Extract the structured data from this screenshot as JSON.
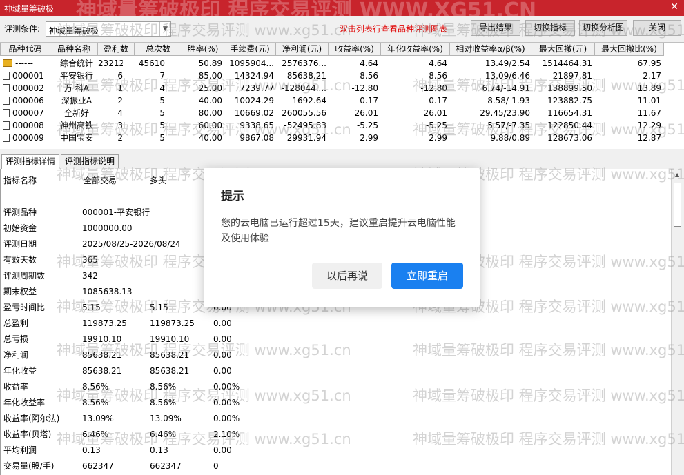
{
  "window": {
    "title": "神域量筹破极",
    "close_glyph": "✕",
    "top_watermark": "神域量筹破极印 程序交易评测 WWW.XG51.CN"
  },
  "toolbar": {
    "label": "评测条件:",
    "combo_value": "神域量筹破极",
    "hint": "双击列表行查看品种评测图表",
    "buttons": [
      "导出结果",
      "切换指标",
      "切换分析图",
      "关闭"
    ]
  },
  "grid": {
    "headers": [
      "品种代码",
      "品种名称",
      "盈利数",
      "总次数",
      "胜率(%)",
      "手续费(元)",
      "净利润(元)",
      "收益率(%)",
      "年化收益率(%)",
      "相对收益率α/β(%)",
      "最大回撤(元)",
      "最大回撤比(%)"
    ],
    "rows": [
      [
        "------",
        "综合统计",
        "23212",
        "45610",
        "50.89",
        "1095904...",
        "2576376...",
        "4.64",
        "4.64",
        "13.49/2.54",
        "1514464.31",
        "67.95"
      ],
      [
        "000001",
        "平安银行",
        "6",
        "7",
        "85.00",
        "14324.94",
        "85638.21",
        "8.56",
        "8.56",
        "13.09/6.46",
        "21897.81",
        "2.17"
      ],
      [
        "000002",
        "万 科A",
        "1",
        "4",
        "25.00",
        "7239.77",
        "-128044....",
        "-12.80",
        "-12.80",
        "6.74/-14.91",
        "138899.50",
        "13.89"
      ],
      [
        "000006",
        "深振业A",
        "2",
        "5",
        "40.00",
        "10024.29",
        "1692.64",
        "0.17",
        "0.17",
        "8.58/-1.93",
        "123882.75",
        "11.01"
      ],
      [
        "000007",
        "全新好",
        "4",
        "5",
        "80.00",
        "10669.02",
        "260055.56",
        "26.01",
        "26.01",
        "29.45/23.90",
        "116654.31",
        "11.67"
      ],
      [
        "000008",
        "神州高铁",
        "3",
        "5",
        "60.00",
        "9338.65",
        "-52495.83",
        "-5.25",
        "-5.25",
        "5.57/-7.35",
        "122850.44",
        "12.29"
      ],
      [
        "000009",
        "中国宝安",
        "2",
        "5",
        "40.00",
        "9867.08",
        "29931.94",
        "2.99",
        "2.99",
        "9.88/0.89",
        "128673.06",
        "12.87"
      ]
    ]
  },
  "tabs": [
    "评测指标详情",
    "评测指标说明"
  ],
  "detail": {
    "headers": [
      "指标名称",
      "全部交易",
      "多头"
    ],
    "rows": [
      [
        "评测品种",
        "000001-平安银行",
        "",
        ""
      ],
      [
        "初始资金",
        "1000000.00",
        "",
        ""
      ],
      [
        "评测日期",
        "2025/08/25-2026/08/24",
        "",
        ""
      ],
      [
        "有效天数",
        "365",
        "",
        ""
      ],
      [
        "评测周期数",
        "342",
        "",
        ""
      ],
      [
        "期末权益",
        "1085638.13",
        "",
        ""
      ],
      [
        "盈亏时间比",
        "5.15",
        "5.15",
        "0.00"
      ],
      [
        "总盈利",
        "119873.25",
        "119873.25",
        "0.00"
      ],
      [
        "总亏损",
        "19910.10",
        "19910.10",
        "0.00"
      ],
      [
        "净利润",
        "85638.21",
        "85638.21",
        "0.00"
      ],
      [
        "年化收益",
        "85638.21",
        "85638.21",
        "0.00"
      ],
      [
        "收益率",
        "8.56%",
        "8.56%",
        "0.00%"
      ],
      [
        "年化收益率",
        "8.56%",
        "8.56%",
        "0.00%"
      ],
      [
        "收益率(阿尔法)",
        "13.09%",
        "13.09%",
        "0.00%"
      ],
      [
        "收益率(贝塔)",
        "6.46%",
        "6.46%",
        "2.10%"
      ],
      [
        "平均利润",
        "0.13",
        "0.13",
        "0.00"
      ],
      [
        "交易量(股/手)",
        "662347",
        "662347",
        "0"
      ]
    ]
  },
  "watermark_text": "神域量筹破极印 程序交易评测 www.xg51.cn",
  "dialog": {
    "title": "提示",
    "message": "您的云电脑已运行超过15天，建议重启提升云电脑性能及使用体验",
    "later_label": "以后再说",
    "restart_label": "立即重启"
  }
}
